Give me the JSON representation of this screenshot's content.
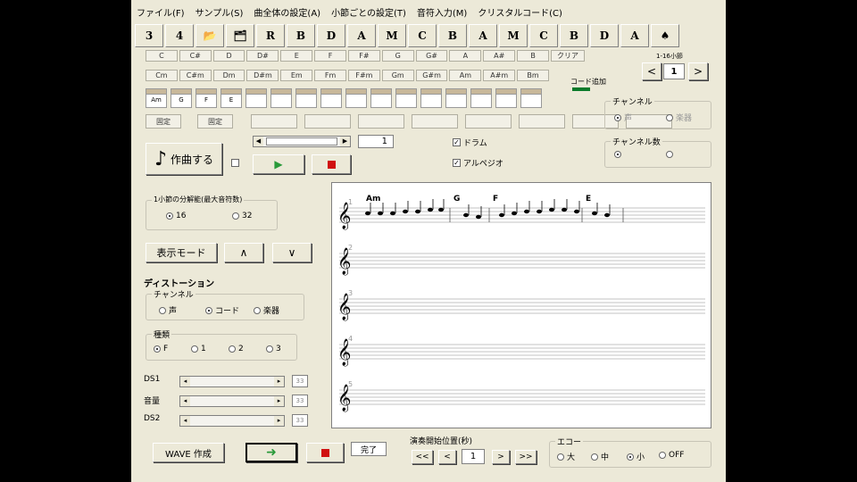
{
  "menu": [
    "ファイル(F)",
    "サンプル(S)",
    "曲全体の設定(A)",
    "小節ごとの設定(T)",
    "音符入力(M)",
    "クリスタルコード(C)"
  ],
  "toolbar": [
    {
      "icon": "bar3-icon",
      "label": "3"
    },
    {
      "icon": "bar4-icon",
      "label": "4"
    },
    {
      "icon": "open-folder-icon",
      "label": "📂"
    },
    {
      "icon": "save-folder-icon",
      "label": "🗂"
    },
    {
      "icon": "piano-r-icon",
      "label": "R"
    },
    {
      "icon": "piano-b-icon",
      "label": "B"
    },
    {
      "icon": "piano-d-icon",
      "label": "D"
    },
    {
      "icon": "piano-a-icon",
      "label": "A"
    },
    {
      "icon": "keys-m-icon",
      "label": "M"
    },
    {
      "icon": "keys-c-icon",
      "label": "C"
    },
    {
      "icon": "keys-b-icon",
      "label": "B"
    },
    {
      "icon": "keys-a-icon",
      "label": "A"
    },
    {
      "icon": "guitar-m-icon",
      "label": "M"
    },
    {
      "icon": "guitar-c-icon",
      "label": "C"
    },
    {
      "icon": "guitar-b-icon",
      "label": "B"
    },
    {
      "icon": "guitar-d-icon",
      "label": "D"
    },
    {
      "icon": "guitar-a-icon",
      "label": "A"
    },
    {
      "icon": "metronome-icon",
      "label": "♠"
    }
  ],
  "chords_major": [
    "C",
    "C#",
    "D",
    "D#",
    "E",
    "F",
    "F#",
    "G",
    "G#",
    "A",
    "A#",
    "B"
  ],
  "clear_label": "クリア",
  "chords_minor": [
    "Cm",
    "C#m",
    "Dm",
    "D#m",
    "Em",
    "Fm",
    "F#m",
    "Gm",
    "G#m",
    "Am",
    "A#m",
    "Bm"
  ],
  "chord_add_label": "コード追加",
  "measure_nav": {
    "range": "1-16小節",
    "prev": "<",
    "value": "1",
    "next": ">"
  },
  "slots": [
    "Am",
    "G",
    "F",
    "E",
    "",
    "",
    "",
    "",
    "",
    "",
    "",
    "",
    "",
    "",
    "",
    ""
  ],
  "fix_buttons": [
    "固定",
    "固定",
    "",
    "",
    "",
    "",
    "",
    "",
    "",
    ""
  ],
  "channel": {
    "title": "チャンネル",
    "options": [
      "声",
      "楽器"
    ]
  },
  "channel_count": {
    "title": "チャンネル数",
    "options": [
      "",
      ""
    ]
  },
  "compose_label": "作曲する",
  "measure_field": "1",
  "drum_label": "ドラム",
  "arpeggio_label": "アルペジオ",
  "division": {
    "title": "1小節の分解能(最大音符数)",
    "options": [
      "16",
      "32"
    ]
  },
  "display_mode_label": "表示モード",
  "up_label": "∧",
  "down_label": "∨",
  "distortion": {
    "title": "ディストーション",
    "channel_title": "チャンネル",
    "channel_options": [
      "声",
      "コード",
      "楽器"
    ],
    "type_title": "種類",
    "type_options": [
      "F",
      "1",
      "2",
      "3"
    ],
    "sliders": [
      {
        "label": "DS1",
        "value": "33"
      },
      {
        "label": "音量",
        "value": "33"
      },
      {
        "label": "DS2",
        "value": "33"
      }
    ]
  },
  "score": {
    "chords": [
      "Am",
      "G",
      "F",
      "E"
    ],
    "staff_numbers": [
      "1",
      "2",
      "3",
      "4",
      "5"
    ]
  },
  "footer": {
    "wave_label": "WAVE 作成",
    "play_icon": "play-arrow-icon",
    "stop_icon": "stop-icon",
    "status": "完了",
    "start_position_title": "演奏開始位置(秒)",
    "nav": [
      "<<",
      "<",
      ">",
      ">>"
    ],
    "position_value": "1",
    "echo_title": "エコー",
    "echo_options": [
      "大",
      "中",
      "小",
      "OFF"
    ]
  },
  "colors": {
    "window_bg": "#ece9d8",
    "play_green": "#2a9a3a",
    "stop_red": "#d01010",
    "score_bg": "#ffffff"
  }
}
